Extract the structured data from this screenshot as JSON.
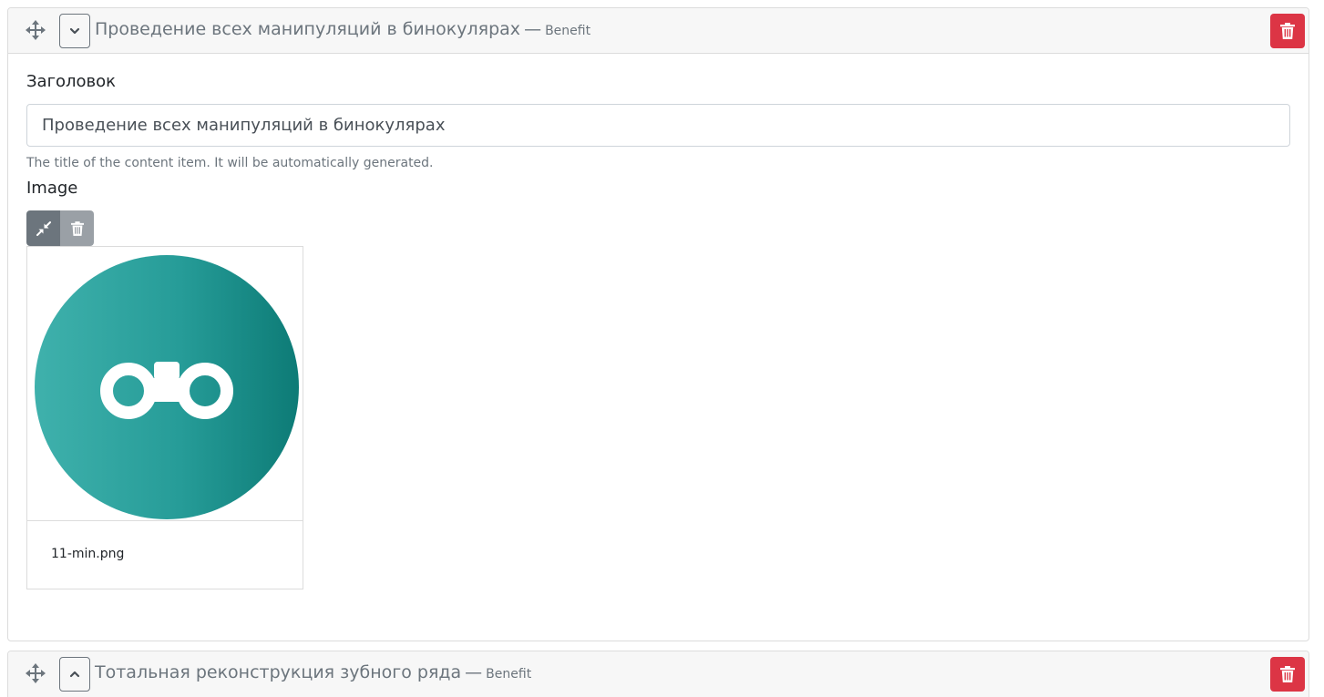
{
  "items": [
    {
      "title": "Проведение всех манипуляций в бинокулярах",
      "separator": "—",
      "type": "Benefit",
      "expanded": true,
      "fields": {
        "title_label": "Заголовок",
        "title_value": "Проведение всех манипуляций в бинокулярах",
        "title_help": "The title of the content item. It will be automatically generated.",
        "image_label": "Image",
        "image_file_name": "11-min.png"
      }
    },
    {
      "title": "Тотальная реконструкция зубного ряда",
      "separator": "—",
      "type": "Benefit",
      "expanded": false
    }
  ],
  "icons": {
    "drag": "move-arrows-icon",
    "collapse": "chevron-down-icon",
    "expand": "chevron-up-icon",
    "delete": "trash-icon",
    "compress": "compress-arrows-icon",
    "thumbnail": "binoculars-icon"
  },
  "colors": {
    "danger": "#dc3545",
    "secondary": "#6c757d",
    "header_bg": "#f7f7f7",
    "thumb_teal": "#269c98"
  }
}
